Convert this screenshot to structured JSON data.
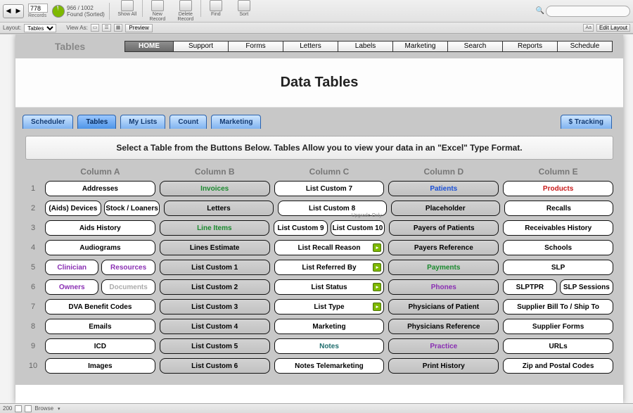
{
  "toolbar": {
    "record_value": "778",
    "record_label": "Records",
    "found_count": "966 / 1002",
    "found_label": "Found (Sorted)",
    "buttons": [
      "Show All",
      "New Record",
      "Delete Record",
      "Find",
      "Sort"
    ],
    "search_placeholder": ""
  },
  "layoutbar": {
    "layout_label": "Layout:",
    "layout_value": "Tables",
    "viewas_label": "View As:",
    "preview": "Preview",
    "aa": "Aa",
    "edit_layout": "Edit Layout"
  },
  "header": {
    "tables_label": "Tables",
    "nav": [
      "HOME",
      "Support",
      "Forms",
      "Letters",
      "Labels",
      "Marketing",
      "Search",
      "Reports",
      "Schedule"
    ],
    "nav_widths": [
      70,
      78,
      78,
      78,
      78,
      78,
      78,
      78,
      78
    ]
  },
  "title": "Data Tables",
  "tabs_left": [
    "Scheduler",
    "Tables",
    "My Lists",
    "Count",
    "Marketing"
  ],
  "tab_active_index": 1,
  "tab_right": "$ Tracking",
  "instruction": "Select a Table from the Buttons Below. Tables Allow you to view your data in an \"Excel\" Type Format.",
  "columns": [
    "Column A",
    "Column B",
    "Column C",
    "Column D",
    "Column E"
  ],
  "rows": [
    {
      "n": "1",
      "cells": [
        [
          {
            "t": "Addresses"
          }
        ],
        [
          {
            "t": "Invoices",
            "g": true,
            "c": "c-green"
          }
        ],
        [
          {
            "t": "List Custom 7"
          }
        ],
        [
          {
            "t": "Patients",
            "g": true,
            "c": "c-blue"
          }
        ],
        [
          {
            "t": "Products",
            "c": "c-red"
          }
        ]
      ]
    },
    {
      "n": "2",
      "cells": [
        [
          {
            "t": "(Aids) Devices"
          },
          {
            "t": "Stock / Loaners"
          }
        ],
        [
          {
            "t": "Letters",
            "g": true
          }
        ],
        [
          {
            "t": "List Custom 8"
          }
        ],
        [
          {
            "t": "Placeholder",
            "g": true
          }
        ],
        [
          {
            "t": "Recalls"
          }
        ]
      ]
    },
    {
      "n": "3",
      "cells": [
        [
          {
            "t": "Aids History"
          }
        ],
        [
          {
            "t": "Line Items",
            "g": true,
            "c": "c-green"
          }
        ],
        [
          {
            "t": "List Custom 9"
          },
          {
            "t": "List Custom 10"
          }
        ],
        [
          {
            "t": "Payers of Patients",
            "g": true
          }
        ],
        [
          {
            "t": "Receivables History"
          }
        ]
      ],
      "upg": true
    },
    {
      "n": "4",
      "cells": [
        [
          {
            "t": "Audiograms"
          }
        ],
        [
          {
            "t": "Lines Estimate",
            "g": true
          }
        ],
        [
          {
            "t": "List Recall Reason",
            "b": true
          }
        ],
        [
          {
            "t": "Payers Reference",
            "g": true
          }
        ],
        [
          {
            "t": "Schools"
          }
        ]
      ]
    },
    {
      "n": "5",
      "cells": [
        [
          {
            "t": "Clinician",
            "c": "c-purple"
          },
          {
            "t": "Resources",
            "c": "c-purple"
          }
        ],
        [
          {
            "t": "List Custom 1",
            "g": true
          }
        ],
        [
          {
            "t": "List Referred By",
            "b": true
          }
        ],
        [
          {
            "t": "Payments",
            "g": true,
            "c": "c-green"
          }
        ],
        [
          {
            "t": "SLP"
          }
        ]
      ]
    },
    {
      "n": "6",
      "cells": [
        [
          {
            "t": "Owners",
            "c": "c-purple"
          },
          {
            "t": "Documents",
            "c": "c-gray"
          }
        ],
        [
          {
            "t": "List Custom 2",
            "g": true
          }
        ],
        [
          {
            "t": "List Status",
            "b": true
          }
        ],
        [
          {
            "t": "Phones",
            "g": true,
            "c": "c-purple"
          }
        ],
        [
          {
            "t": "SLPTPR"
          },
          {
            "t": "SLP Sessions"
          }
        ]
      ]
    },
    {
      "n": "7",
      "cells": [
        [
          {
            "t": "DVA Benefit Codes"
          }
        ],
        [
          {
            "t": "List Custom 3",
            "g": true
          }
        ],
        [
          {
            "t": "List Type",
            "b": true
          }
        ],
        [
          {
            "t": "Physicians of Patient",
            "g": true
          }
        ],
        [
          {
            "t": "Supplier Bill To / Ship To"
          }
        ]
      ]
    },
    {
      "n": "8",
      "cells": [
        [
          {
            "t": "Emails"
          }
        ],
        [
          {
            "t": "List Custom 4",
            "g": true
          }
        ],
        [
          {
            "t": "Marketing"
          }
        ],
        [
          {
            "t": "Physicians Reference",
            "g": true
          }
        ],
        [
          {
            "t": "Supplier Forms"
          }
        ]
      ]
    },
    {
      "n": "9",
      "cells": [
        [
          {
            "t": "ICD"
          }
        ],
        [
          {
            "t": "List Custom 5",
            "g": true
          }
        ],
        [
          {
            "t": "Notes",
            "c": "c-teal"
          }
        ],
        [
          {
            "t": "Practice",
            "g": true,
            "c": "c-purple"
          }
        ],
        [
          {
            "t": "URLs"
          }
        ]
      ]
    },
    {
      "n": "10",
      "cells": [
        [
          {
            "t": "Images"
          }
        ],
        [
          {
            "t": "List Custom 6",
            "g": true
          }
        ],
        [
          {
            "t": "Notes Telemarketing"
          }
        ],
        [
          {
            "t": "Print History",
            "g": true
          }
        ],
        [
          {
            "t": "Zip and Postal Codes"
          }
        ]
      ]
    }
  ],
  "status": {
    "count": "200",
    "mode": "Browse"
  },
  "upgrade_text": "Upgrade Only"
}
